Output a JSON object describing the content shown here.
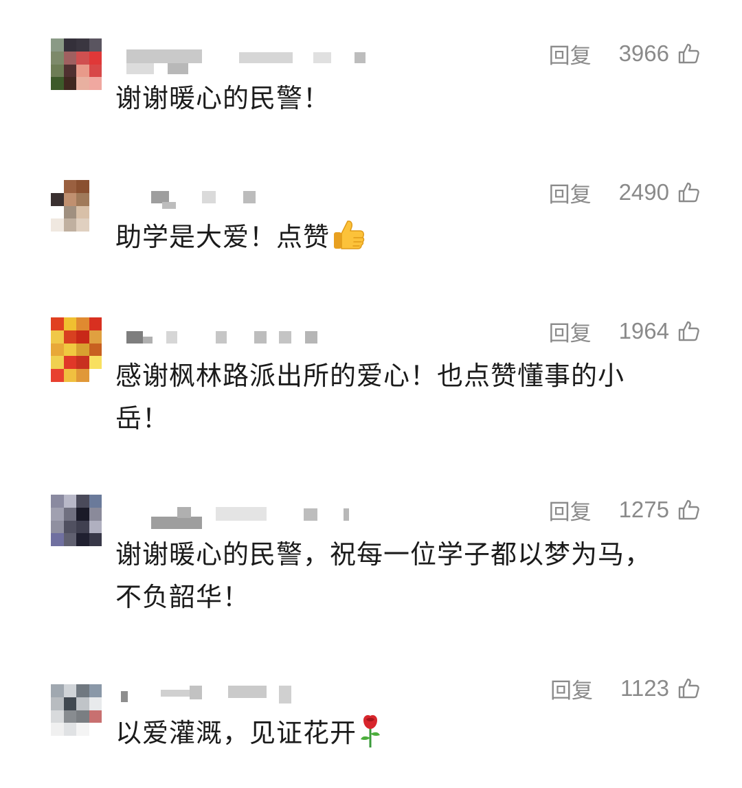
{
  "comments": [
    {
      "reply_label": "回复",
      "likes": "3966",
      "text": "谢谢暖心的民警！"
    },
    {
      "reply_label": "回复",
      "likes": "2490",
      "text": "助学是大爱！点赞",
      "emoji": "thumbs-up"
    },
    {
      "reply_label": "回复",
      "likes": "1964",
      "text": "感谢枫林路派出所的爱心！也点赞懂事的小岳！"
    },
    {
      "reply_label": "回复",
      "likes": "1275",
      "text": "谢谢暖心的民警，祝每一位学子都以梦为马，不负韶华！"
    },
    {
      "reply_label": "回复",
      "likes": "1123",
      "text": "以爱灌溉，见证花开",
      "emoji": "rose"
    }
  ],
  "icons": {
    "like": "thumbs-up-outline-icon"
  },
  "colors": {
    "meta_gray": "#8a8a8a",
    "text": "#1b1b1b",
    "background": "#ffffff"
  }
}
